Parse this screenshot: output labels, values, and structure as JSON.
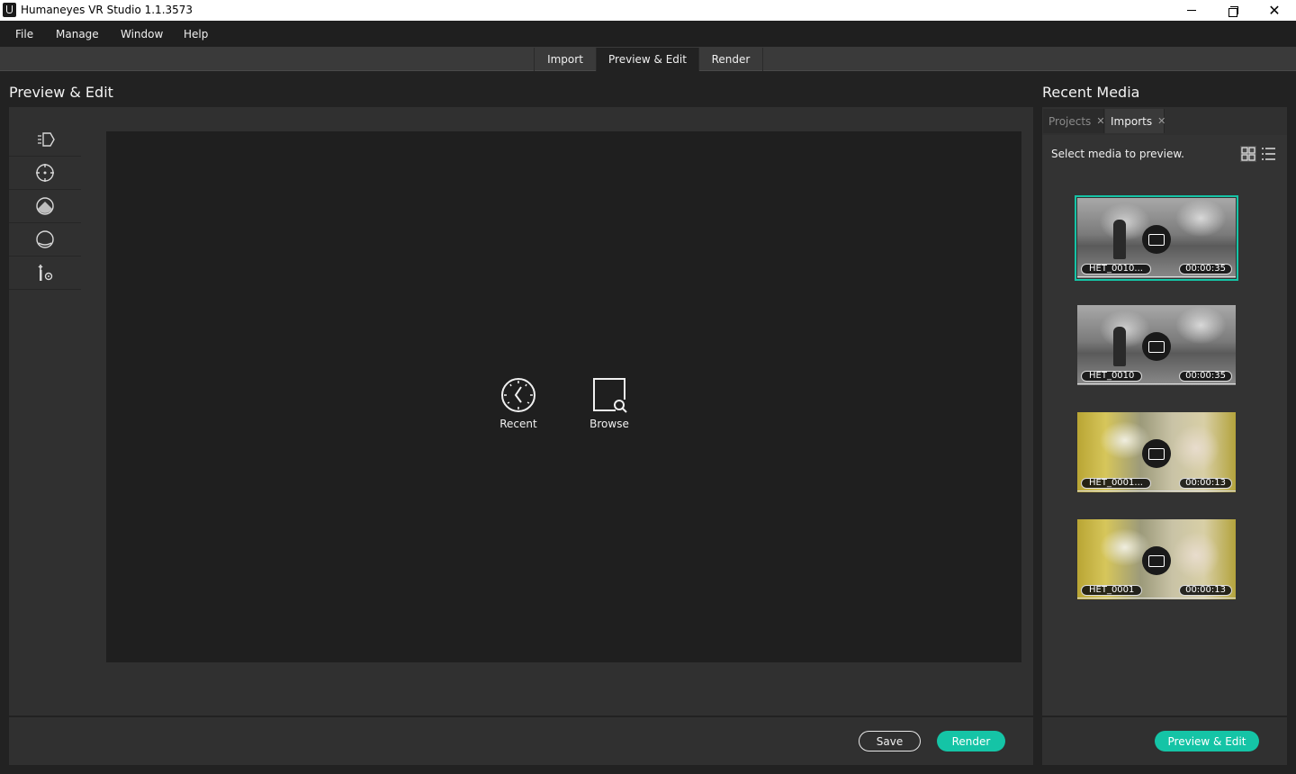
{
  "window": {
    "title": "Humaneyes VR Studio 1.1.3573",
    "minimize_icon": "minimize-icon",
    "maximize_icon": "restore-icon",
    "close_glyph": "✕"
  },
  "menu": {
    "items": [
      "File",
      "Manage",
      "Window",
      "Help"
    ]
  },
  "top_tabs": [
    {
      "label": "Import",
      "active": false
    },
    {
      "label": "Preview & Edit",
      "active": true
    },
    {
      "label": "Render",
      "active": false
    }
  ],
  "main": {
    "title": "Preview & Edit",
    "tools": [
      "transform-icon",
      "crosshair-icon",
      "top-cap-icon",
      "bottom-cap-icon",
      "tools-settings-icon"
    ],
    "actions": {
      "recent_label": "Recent",
      "browse_label": "Browse"
    },
    "buttons": {
      "save_label": "Save",
      "render_label": "Render"
    }
  },
  "recent_media": {
    "title": "Recent Media",
    "tabs": [
      {
        "label": "Projects",
        "active": false
      },
      {
        "label": "Imports",
        "active": true
      }
    ],
    "tab_close_glyph": "✕",
    "hint": "Select media to preview.",
    "items": [
      {
        "name": "HET_0010...",
        "duration": "00:00:35",
        "thumbnail": "arena",
        "selected": true
      },
      {
        "name": "HET_0010",
        "duration": "00:00:35",
        "thumbnail": "arena",
        "selected": false
      },
      {
        "name": "HET_0001...",
        "duration": "00:00:13",
        "thumbnail": "yellow",
        "selected": false
      },
      {
        "name": "HET_0001",
        "duration": "00:00:13",
        "thumbnail": "yellow",
        "selected": false
      }
    ],
    "preview_edit_label": "Preview & Edit"
  },
  "colors": {
    "accent": "#15c4a6",
    "background": "#222222",
    "panel": "#303030"
  }
}
